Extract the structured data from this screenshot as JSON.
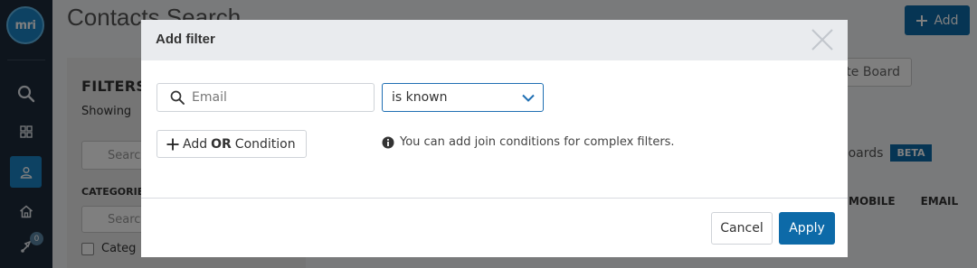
{
  "app": {
    "logo_text": "mri",
    "page_title": "Contacts Search",
    "add_button_label": "Add",
    "sidebar_badge_count": "0"
  },
  "filters_panel": {
    "heading": "FILTERS",
    "showing_text": "Showing",
    "search_placeholder": "Search",
    "categories_heading": "CATEGORIES",
    "category_search_placeholder": "Search",
    "category_item": "Categ"
  },
  "right_panel": {
    "board_button": "te Board",
    "boards_label": "Boards",
    "beta_badge": "BETA",
    "columns": [
      "MOBILE",
      "EMAIL"
    ]
  },
  "modal": {
    "title": "Add filter",
    "field_value": "Email",
    "operator_value": "is known",
    "add_or_prefix": "Add",
    "add_or_keyword": "OR",
    "add_or_suffix": "Condition",
    "hint": "You can add join conditions for complex filters.",
    "cancel_label": "Cancel",
    "apply_label": "Apply"
  },
  "colors": {
    "sidebar": "#1c2b3a",
    "primary": "#0d6aa8",
    "overlay": "rgba(0,0,0,0.5)"
  },
  "icons": {
    "sidebar": [
      "search-icon",
      "grid-icon",
      "contacts-icon",
      "home-icon",
      "rocket-icon"
    ],
    "modal": [
      "search-icon",
      "chevron-down-icon",
      "plus-icon",
      "info-icon",
      "close-icon"
    ]
  }
}
